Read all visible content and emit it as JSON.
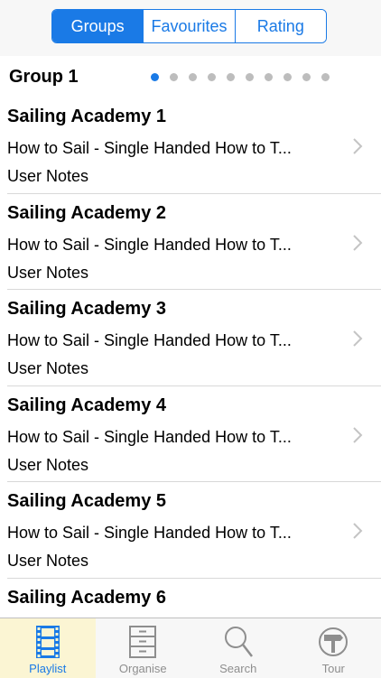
{
  "segments": [
    {
      "label": "Groups",
      "active": true
    },
    {
      "label": "Favourites",
      "active": false
    },
    {
      "label": "Rating",
      "active": false
    }
  ],
  "group": {
    "title": "Group 1",
    "page_count": 10,
    "current_page": 1
  },
  "items": [
    {
      "title": "Sailing Academy 1",
      "subtitle": "How to Sail - Single Handed How to T...",
      "notes": "User Notes"
    },
    {
      "title": "Sailing Academy 2",
      "subtitle": "How to Sail - Single Handed How to T...",
      "notes": "User Notes"
    },
    {
      "title": "Sailing Academy 3",
      "subtitle": "How to Sail - Single Handed How to T...",
      "notes": "User Notes"
    },
    {
      "title": "Sailing Academy 4",
      "subtitle": "How to Sail - Single Handed How to T...",
      "notes": "User Notes"
    },
    {
      "title": "Sailing Academy 5",
      "subtitle": "How to Sail - Single Handed How to T...",
      "notes": "User Notes"
    },
    {
      "title": "Sailing Academy 6",
      "subtitle": "",
      "notes": ""
    }
  ],
  "tabs": [
    {
      "label": "Playlist",
      "icon": "film-icon",
      "active": true
    },
    {
      "label": "Organise",
      "icon": "cabinet-icon",
      "active": false
    },
    {
      "label": "Search",
      "icon": "search-icon",
      "active": false
    },
    {
      "label": "Tour",
      "icon": "signpost-icon",
      "active": false
    }
  ],
  "colors": {
    "accent": "#1a7ae6",
    "tab_active_bg": "#fbf5d3",
    "inactive": "#8e8e8e"
  }
}
